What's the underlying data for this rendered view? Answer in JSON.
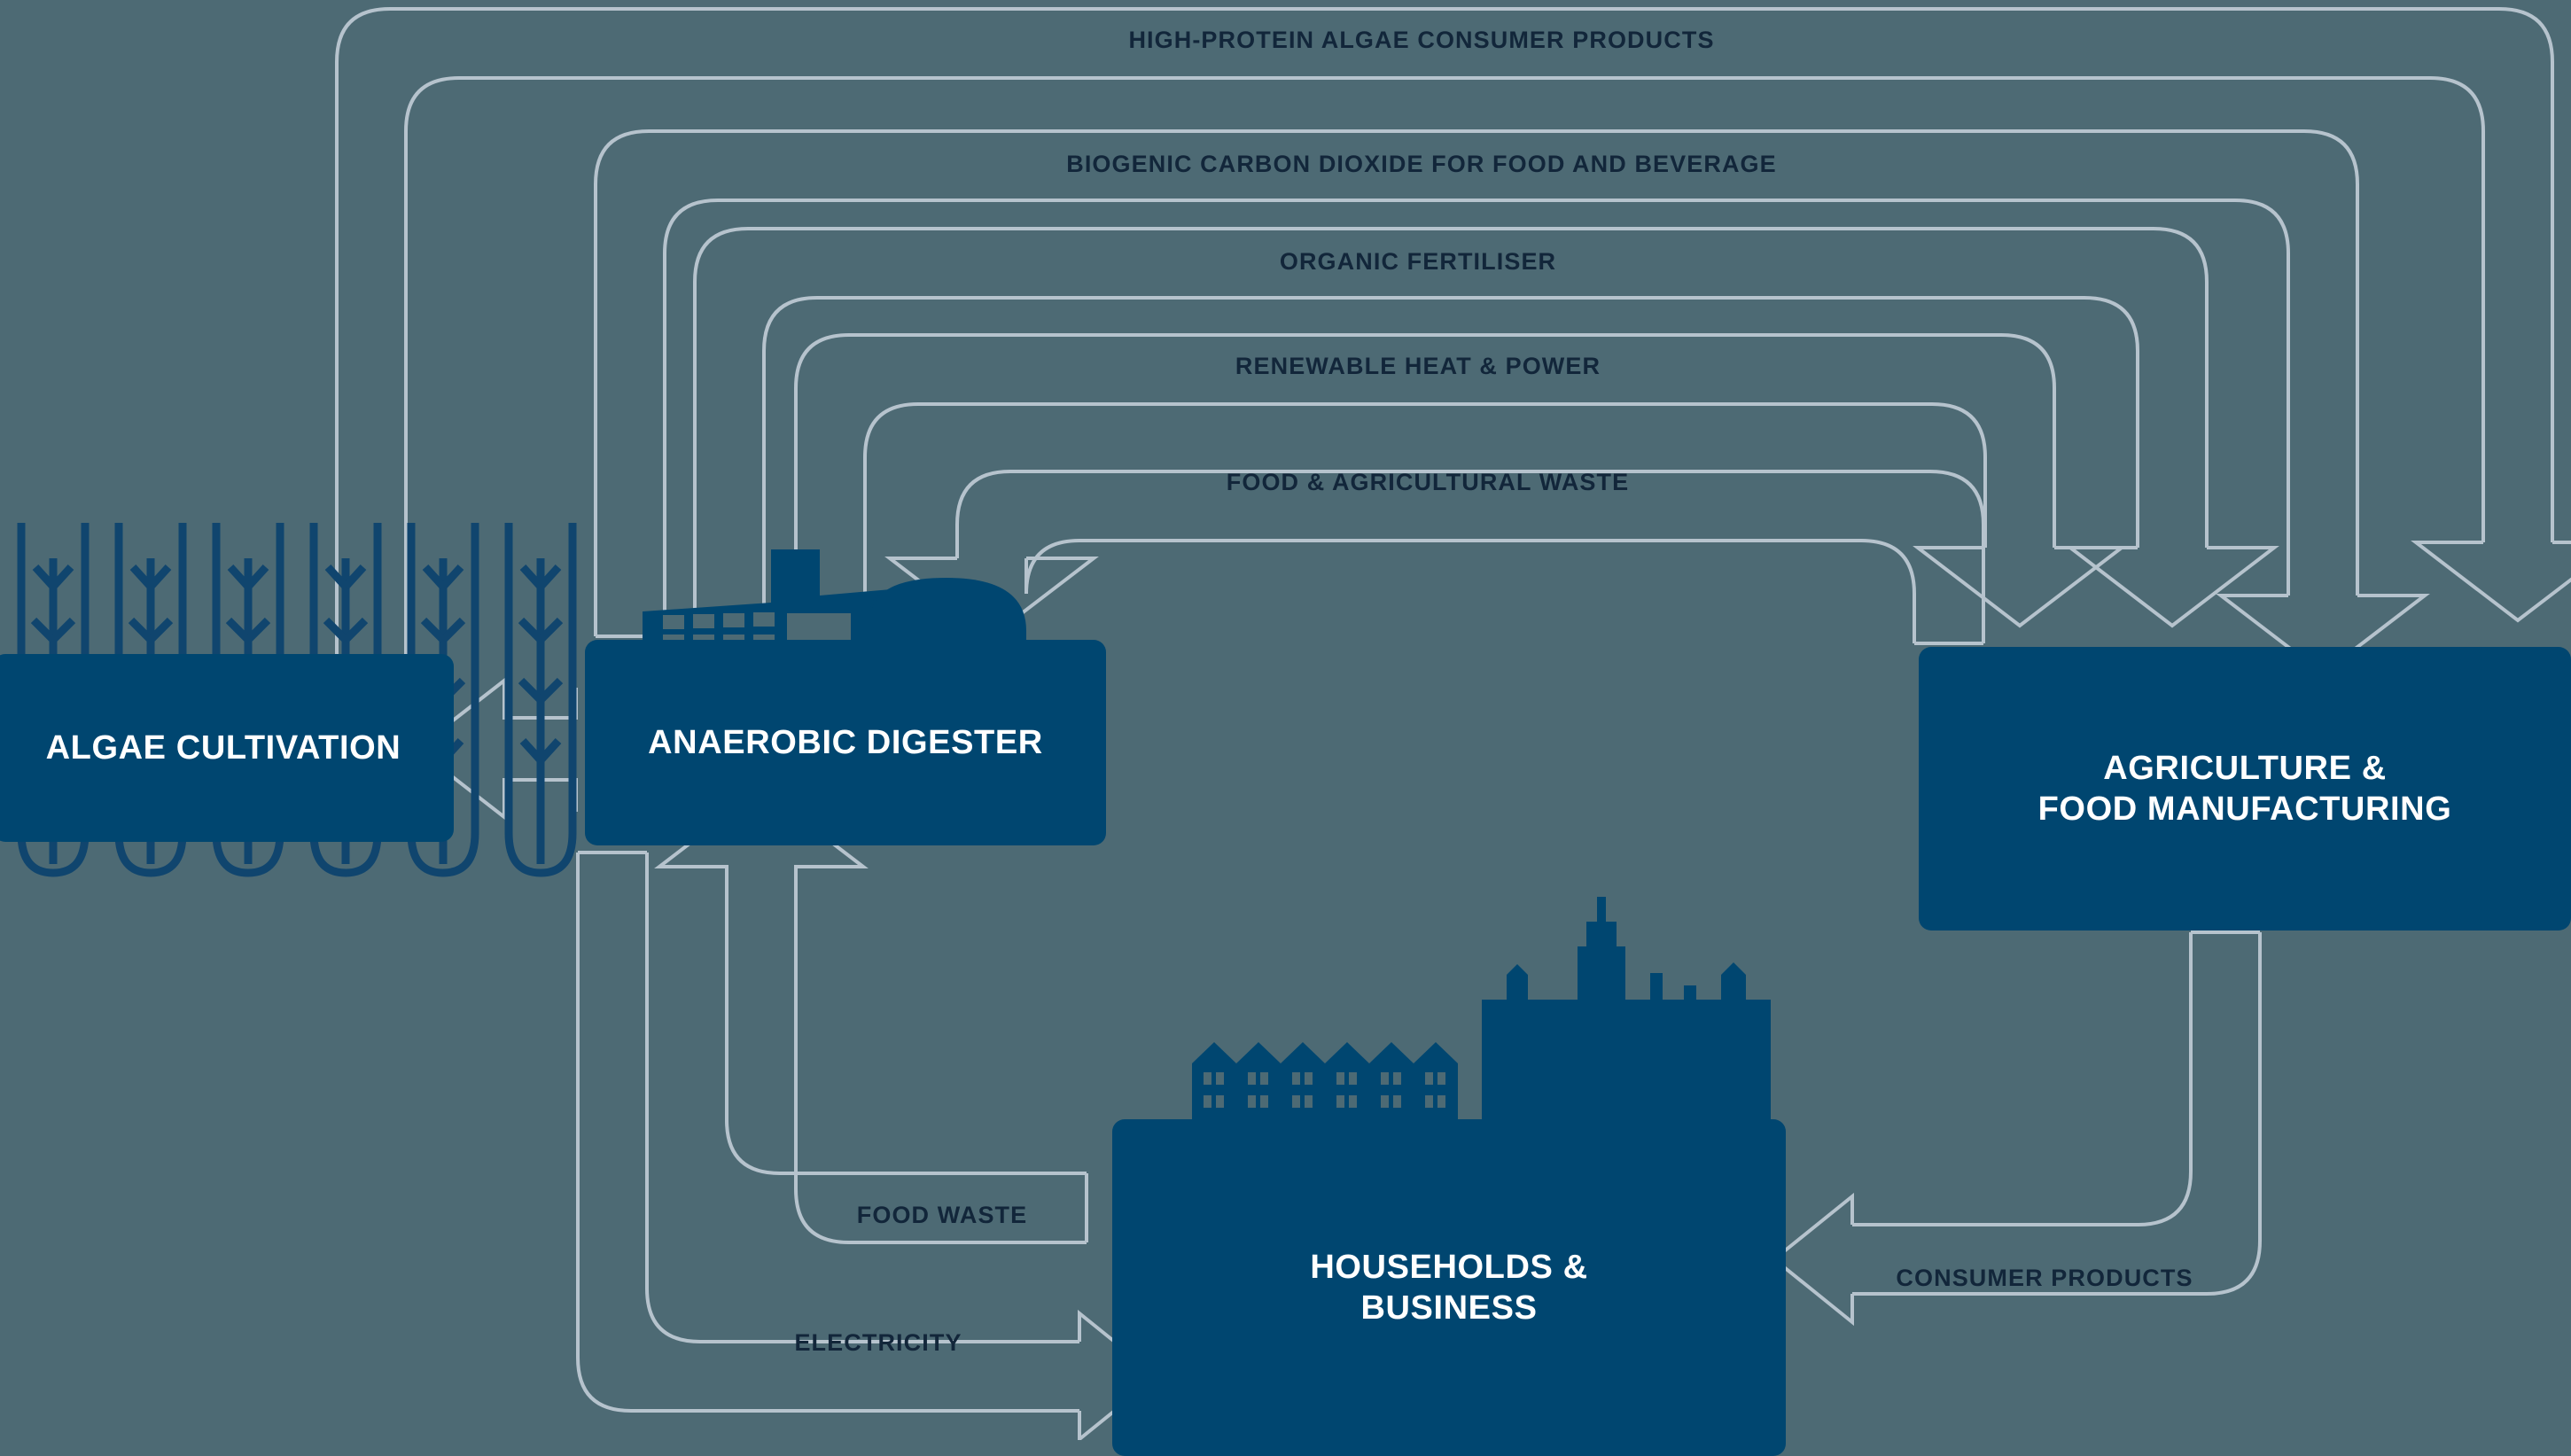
{
  "diagram": {
    "title": "Algae biorefinery circular economy flow diagram",
    "background_color": "#4d6a74",
    "node_color": "#004670",
    "line_color": "#b6c3cd",
    "label_color": "#12263a"
  },
  "nodes": [
    {
      "id": "algae",
      "label": "ALGAE CULTIVATION",
      "icon": "algae-tubes-icon"
    },
    {
      "id": "digester",
      "label": "ANAEROBIC DIGESTER",
      "icon": "digester-plant-icon"
    },
    {
      "id": "agri",
      "label_line1": "AGRICULTURE &",
      "label_line2": "FOOD MANUFACTURING",
      "icon": "farm-icon"
    },
    {
      "id": "house",
      "label_line1": "HOUSEHOLDS &",
      "label_line2": "BUSINESS",
      "icon": "townscape-icon"
    }
  ],
  "flows": [
    {
      "id": "high-protein-algae",
      "label": "HIGH-PROTEIN ALGAE CONSUMER PRODUCTS",
      "from": "algae",
      "to": "agriculture-and-food-manufacturing"
    },
    {
      "id": "biogenic-co2",
      "label": "BIOGENIC CARBON DIOXIDE FOR FOOD AND BEVERAGE",
      "from": "anaerobic-digester",
      "to": "agriculture-and-food-manufacturing"
    },
    {
      "id": "organic-fertiliser",
      "label": "ORGANIC FERTILISER",
      "from": "anaerobic-digester",
      "to": "agriculture-and-food-manufacturing"
    },
    {
      "id": "renewable-heat-power",
      "label": "RENEWABLE HEAT & POWER",
      "from": "anaerobic-digester",
      "to": "agriculture-and-food-manufacturing"
    },
    {
      "id": "food-agri-waste",
      "label": "FOOD & AGRICULTURAL WASTE",
      "from": "agriculture-and-food-manufacturing",
      "to": "anaerobic-digester"
    },
    {
      "id": "food-waste",
      "label": "FOOD WASTE",
      "from": "households-and-business",
      "to": "anaerobic-digester"
    },
    {
      "id": "electricity",
      "label": "ELECTRICITY",
      "from": "anaerobic-digester",
      "to": "households-and-business"
    },
    {
      "id": "consumer-products",
      "label": "CONSUMER PRODUCTS",
      "from": "agriculture-and-food-manufacturing",
      "to": "households-and-business"
    }
  ],
  "chart_data": {
    "type": "diagram",
    "title": "Algae biorefinery circular economy flow diagram",
    "nodes": [
      "ALGAE CULTIVATION",
      "ANAEROBIC DIGESTER",
      "AGRICULTURE & FOOD MANUFACTURING",
      "HOUSEHOLDS & BUSINESS"
    ],
    "edges": [
      {
        "source": "ALGAE CULTIVATION",
        "target": "AGRICULTURE & FOOD MANUFACTURING",
        "label": "HIGH-PROTEIN ALGAE CONSUMER PRODUCTS"
      },
      {
        "source": "ANAEROBIC DIGESTER",
        "target": "AGRICULTURE & FOOD MANUFACTURING",
        "label": "BIOGENIC CARBON DIOXIDE FOR FOOD AND BEVERAGE"
      },
      {
        "source": "ANAEROBIC DIGESTER",
        "target": "AGRICULTURE & FOOD MANUFACTURING",
        "label": "ORGANIC FERTILISER"
      },
      {
        "source": "ANAEROBIC DIGESTER",
        "target": "AGRICULTURE & FOOD MANUFACTURING",
        "label": "RENEWABLE HEAT & POWER"
      },
      {
        "source": "AGRICULTURE & FOOD MANUFACTURING",
        "target": "ANAEROBIC DIGESTER",
        "label": "FOOD & AGRICULTURAL WASTE"
      },
      {
        "source": "HOUSEHOLDS & BUSINESS",
        "target": "ANAEROBIC DIGESTER",
        "label": "FOOD WASTE"
      },
      {
        "source": "ANAEROBIC DIGESTER",
        "target": "HOUSEHOLDS & BUSINESS",
        "label": "ELECTRICITY"
      },
      {
        "source": "AGRICULTURE & FOOD MANUFACTURING",
        "target": "HOUSEHOLDS & BUSINESS",
        "label": "CONSUMER PRODUCTS"
      },
      {
        "source": "ANAEROBIC DIGESTER",
        "target": "ALGAE CULTIVATION",
        "label": ""
      }
    ]
  }
}
